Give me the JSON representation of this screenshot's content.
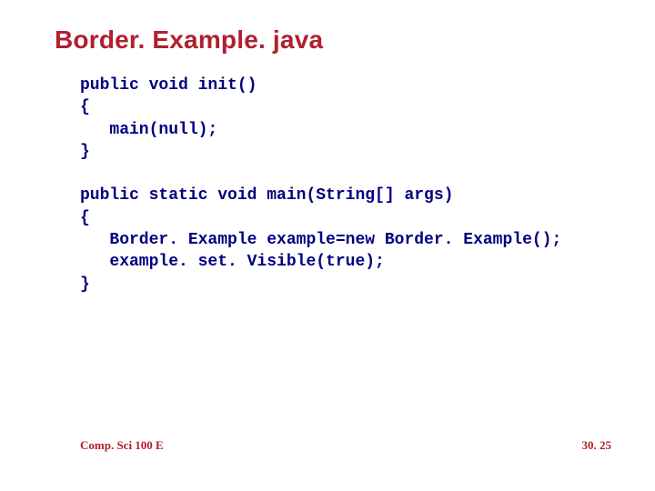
{
  "title": "Border. Example. java",
  "code": "public void init()\n{\n   main(null);\n}\n\npublic static void main(String[] args)\n{\n   Border. Example example=new Border. Example();\n   example. set. Visible(true);\n}",
  "footer": {
    "left": "Comp. Sci 100 E",
    "right": "30. 25"
  }
}
